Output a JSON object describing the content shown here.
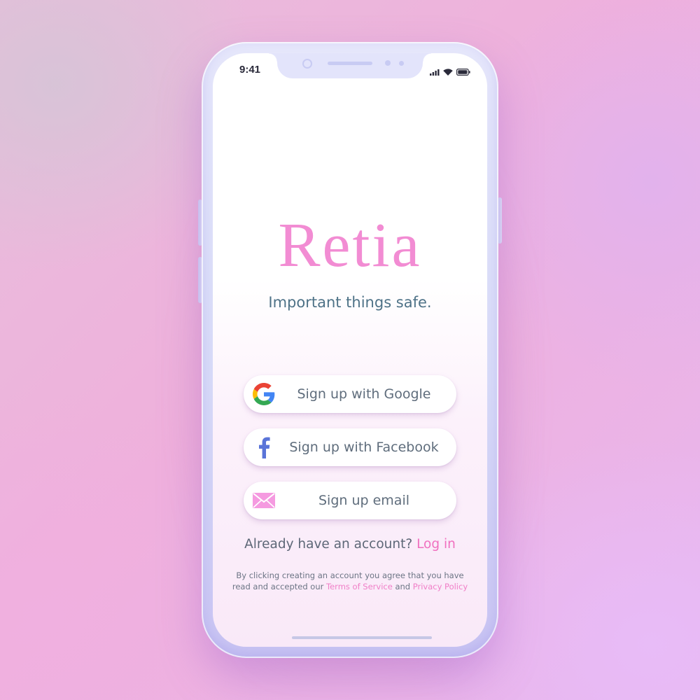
{
  "status_bar": {
    "time": "9:41",
    "icons": [
      "cellular-signal-icon",
      "wifi-icon",
      "battery-icon"
    ]
  },
  "app": {
    "name": "Retia",
    "tagline": "Important things safe."
  },
  "signup_buttons": [
    {
      "label": "Sign up with Google",
      "icon": "google-icon"
    },
    {
      "label": "Sign up with Facebook",
      "icon": "facebook-icon"
    },
    {
      "label": "Sign up email",
      "icon": "envelope-icon"
    }
  ],
  "login_prompt": {
    "text": "Already have an account?",
    "link": "Log in"
  },
  "legal": {
    "line1": "By clicking creating an account you agree that you have",
    "line2_prefix": "read and accepted our",
    "terms_link": "Terms of Service",
    "conjunction": "and",
    "privacy_link": "Privacy Policy"
  },
  "colors": {
    "brand_pink": "#f28cd3",
    "link_pink": "#f06fbf",
    "tagline_teal": "#4e7287",
    "facebook_blue": "#5a74d8",
    "email_pink": "#f59ae0"
  }
}
